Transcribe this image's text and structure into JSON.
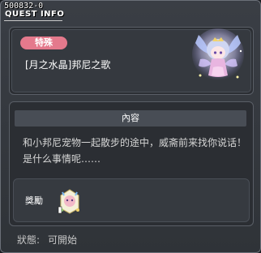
{
  "header": {
    "quest_id": "500832-0",
    "title": "QUEST INFO"
  },
  "quest": {
    "badge": "特殊",
    "name": "[月之水晶]邦尼之歌"
  },
  "content": {
    "section_title": "內容",
    "description": "和小邦尼宠物一起散步的途中，威斋前来找你说话！是什么事情呢……"
  },
  "reward": {
    "label": "獎勵",
    "item_icon": "reward-item-icon"
  },
  "status": {
    "label": "狀態:",
    "value": "可開始"
  },
  "colors": {
    "badge": "#e4798c",
    "background": "#2f3338",
    "header_bar": "#484d55"
  }
}
